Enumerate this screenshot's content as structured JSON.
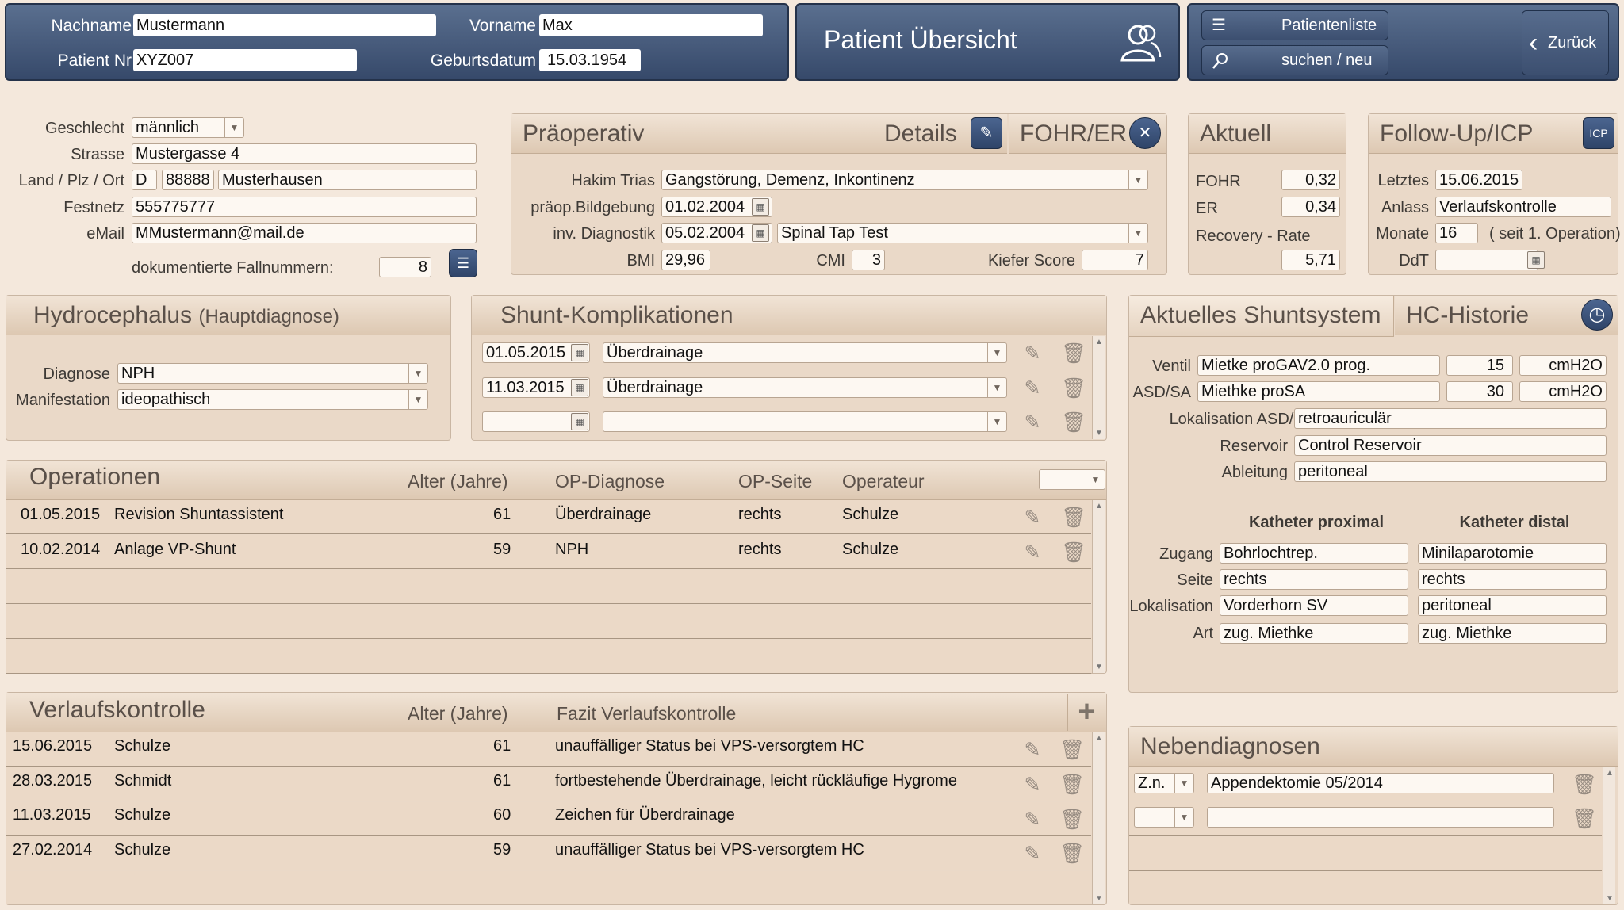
{
  "header": {
    "nachname_label": "Nachname",
    "nachname_value": "Mustermann",
    "vorname_label": "Vorname",
    "vorname_value": "Max",
    "patient_nr_label": "Patient Nr",
    "patient_nr_value": "XYZ007",
    "geburtsdatum_label": "Geburtsdatum",
    "geburtsdatum_value": "15.03.1954",
    "title": "Patient Übersicht",
    "patientenliste": "Patientenliste",
    "suchen": "suchen / neu",
    "zurueck": "Zurück",
    "accent": "#3b4e6e"
  },
  "patient": {
    "geschlecht_label": "Geschlecht",
    "geschlecht_value": "männlich",
    "strasse_label": "Strasse",
    "strasse_value": "Mustergasse 4",
    "land_label": "Land / Plz / Ort",
    "land_value": "D",
    "plz_value": "88888",
    "ort_value": "Musterhausen",
    "festnetz_label": "Festnetz",
    "festnetz_value": "555775777",
    "email_label": "eMail",
    "email_value": "MMustermann@mail.de",
    "fallnummern_label": "dokumentierte Fallnummern:",
    "fallnummern_value": "8"
  },
  "praeop": {
    "title": "Präoperativ",
    "details": "Details",
    "fohr_er": "FOHR/ER",
    "hakim_label": "Hakim Trias",
    "hakim_value": "Gangstörung, Demenz, Inkontinenz",
    "bildgebung_label": "präop.Bildgebung",
    "bildgebung_value": "01.02.2004",
    "diagnostik_label": "inv. Diagnostik",
    "diagnostik_date": "05.02.2004",
    "diagnostik_value": "Spinal Tap Test",
    "bmi_label": "BMI",
    "bmi_value": "29,96",
    "cmi_label": "CMI",
    "cmi_value": "3",
    "kiefer_label": "Kiefer Score",
    "kiefer_value": "7"
  },
  "aktuell": {
    "title": "Aktuell",
    "fohr_label": "FOHR",
    "fohr_value": "0,32",
    "er_label": "ER",
    "er_value": "0,34",
    "recovery_label": "Recovery - Rate",
    "recovery_value": "5,71"
  },
  "followup": {
    "title": "Follow-Up/ICP",
    "icp": "ICP",
    "letztes_label": "Letztes",
    "letztes_value": "15.06.2015",
    "anlass_label": "Anlass",
    "anlass_value": "Verlaufskontrolle",
    "monate_label": "Monate",
    "monate_value": "16",
    "monate_note": "( seit 1. Operation)",
    "ddt_label": "DdT",
    "ddt_value": ""
  },
  "hydro": {
    "title": "Hydrocephalus",
    "subtitle": "(Hauptdiagnose)",
    "diagnose_label": "Diagnose",
    "diagnose_value": "NPH",
    "manifestation_label": "Manifestation",
    "manifestation_value": "ideopathisch"
  },
  "shunt_komp": {
    "title": "Shunt-Komplikationen",
    "rows": [
      {
        "date": "01.05.2015",
        "value": "Überdrainage"
      },
      {
        "date": "11.03.2015",
        "value": "Überdrainage"
      },
      {
        "date": "",
        "value": ""
      }
    ]
  },
  "operationen": {
    "title": "Operationen",
    "col_alter": "Alter (Jahre)",
    "col_diag": "OP-Diagnose",
    "col_seite": "OP-Seite",
    "col_operateur": "Operateur",
    "rows": [
      {
        "date": "01.05.2015",
        "op": "Revision Shuntassistent",
        "alter": "61",
        "diag": "Überdrainage",
        "seite": "rechts",
        "operateur": "Schulze"
      },
      {
        "date": "10.02.2014",
        "op": "Anlage VP-Shunt",
        "alter": "59",
        "diag": "NPH",
        "seite": "rechts",
        "operateur": "Schulze"
      }
    ]
  },
  "verlauf": {
    "title": "Verlaufskontrolle",
    "col_alter": "Alter (Jahre)",
    "col_fazit": "Fazit Verlaufskontrolle",
    "rows": [
      {
        "date": "15.06.2015",
        "arzt": "Schulze",
        "alter": "61",
        "fazit": "unauffälliger Status bei VPS-versorgtem HC"
      },
      {
        "date": "28.03.2015",
        "arzt": "Schmidt",
        "alter": "61",
        "fazit": "fortbestehende Überdrainage, leicht rückläufige Hygrome"
      },
      {
        "date": "11.03.2015",
        "arzt": "Schulze",
        "alter": "60",
        "fazit": "Zeichen für Überdrainage"
      },
      {
        "date": "27.02.2014",
        "arzt": "Schulze",
        "alter": "59",
        "fazit": "unauffälliger Status bei VPS-versorgtem HC"
      }
    ]
  },
  "shuntsystem": {
    "tab_aktuell": "Aktuelles Shuntsystem",
    "tab_historie": "HC-Historie",
    "ventil_label": "Ventil",
    "ventil_value": "Mietke proGAV2.0 prog.",
    "ventil_num": "15",
    "ventil_unit": "cmH2O",
    "asd_label": "ASD/SA",
    "asd_value": "Miethke proSA",
    "asd_num": "30",
    "asd_unit": "cmH2O",
    "lok_asd_label": "Lokalisation ASD/SA",
    "lok_asd_value": "retroauriculär",
    "reservoir_label": "Reservoir",
    "reservoir_value": "Control Reservoir",
    "ableitung_label": "Ableitung",
    "ableitung_value": "peritoneal",
    "kath_prox": "Katheter proximal",
    "kath_dist": "Katheter distal",
    "zugang_label": "Zugang",
    "zugang_prox": "Bohrlochtrep.",
    "zugang_dist": "Minilaparotomie",
    "seite_label": "Seite",
    "seite_prox": "rechts",
    "seite_dist": "rechts",
    "lok_label": "Lokalisation",
    "lok_prox": "Vorderhorn SV",
    "lok_dist": "peritoneal",
    "art_label": "Art",
    "art_prox": "zug. Miethke",
    "art_dist": "zug. Miethke"
  },
  "neben": {
    "title": "Nebendiagnosen",
    "rows": [
      {
        "prefix": "Z.n.",
        "value": "Appendektomie 05/2014"
      },
      {
        "prefix": "",
        "value": ""
      }
    ]
  }
}
